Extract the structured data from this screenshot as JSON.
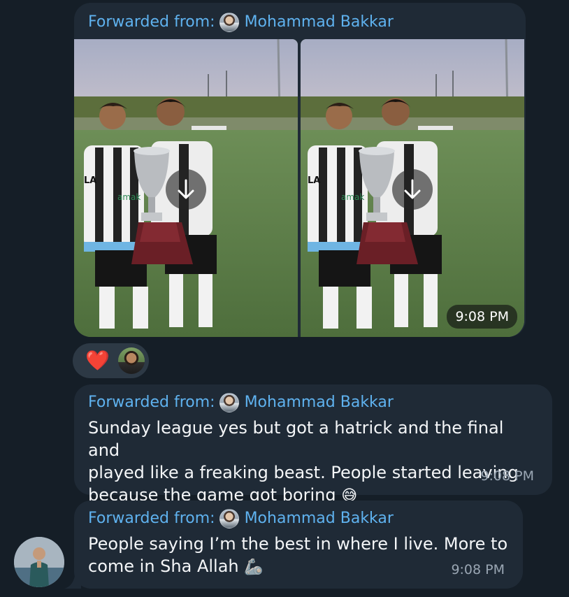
{
  "messages": [
    {
      "forward_prefix": "Forwarded from:",
      "forward_name": "Mohammad Bakkar",
      "photos": [
        {
          "label": "LA",
          "sponsor": "amak"
        },
        {
          "label": "LA",
          "sponsor": "amak"
        }
      ],
      "time": "9:08 PM",
      "reactions": [
        {
          "emoji": "❤️"
        }
      ]
    },
    {
      "forward_prefix": "Forwarded from:",
      "forward_name": "Mohammad Bakkar",
      "text": "Sunday league yes but got a hatrick and the final and\nplayed like a freaking beast. People started leaving\nbecause the game got boring",
      "emoji": "😅",
      "time": "9:08 PM"
    },
    {
      "forward_prefix": "Forwarded from:",
      "forward_name": "Mohammad Bakkar",
      "text": "People saying I’m the best in where I live. More to\ncome in Sha Allah",
      "emoji": "🦾",
      "time": "9:08 PM"
    }
  ],
  "colors": {
    "background": "#151e27",
    "bubble": "#1f2a36",
    "accent_link": "#5fb2ef",
    "heart": "#e12a35"
  },
  "icons": {
    "download": "arrow-down",
    "reaction": "heart"
  }
}
